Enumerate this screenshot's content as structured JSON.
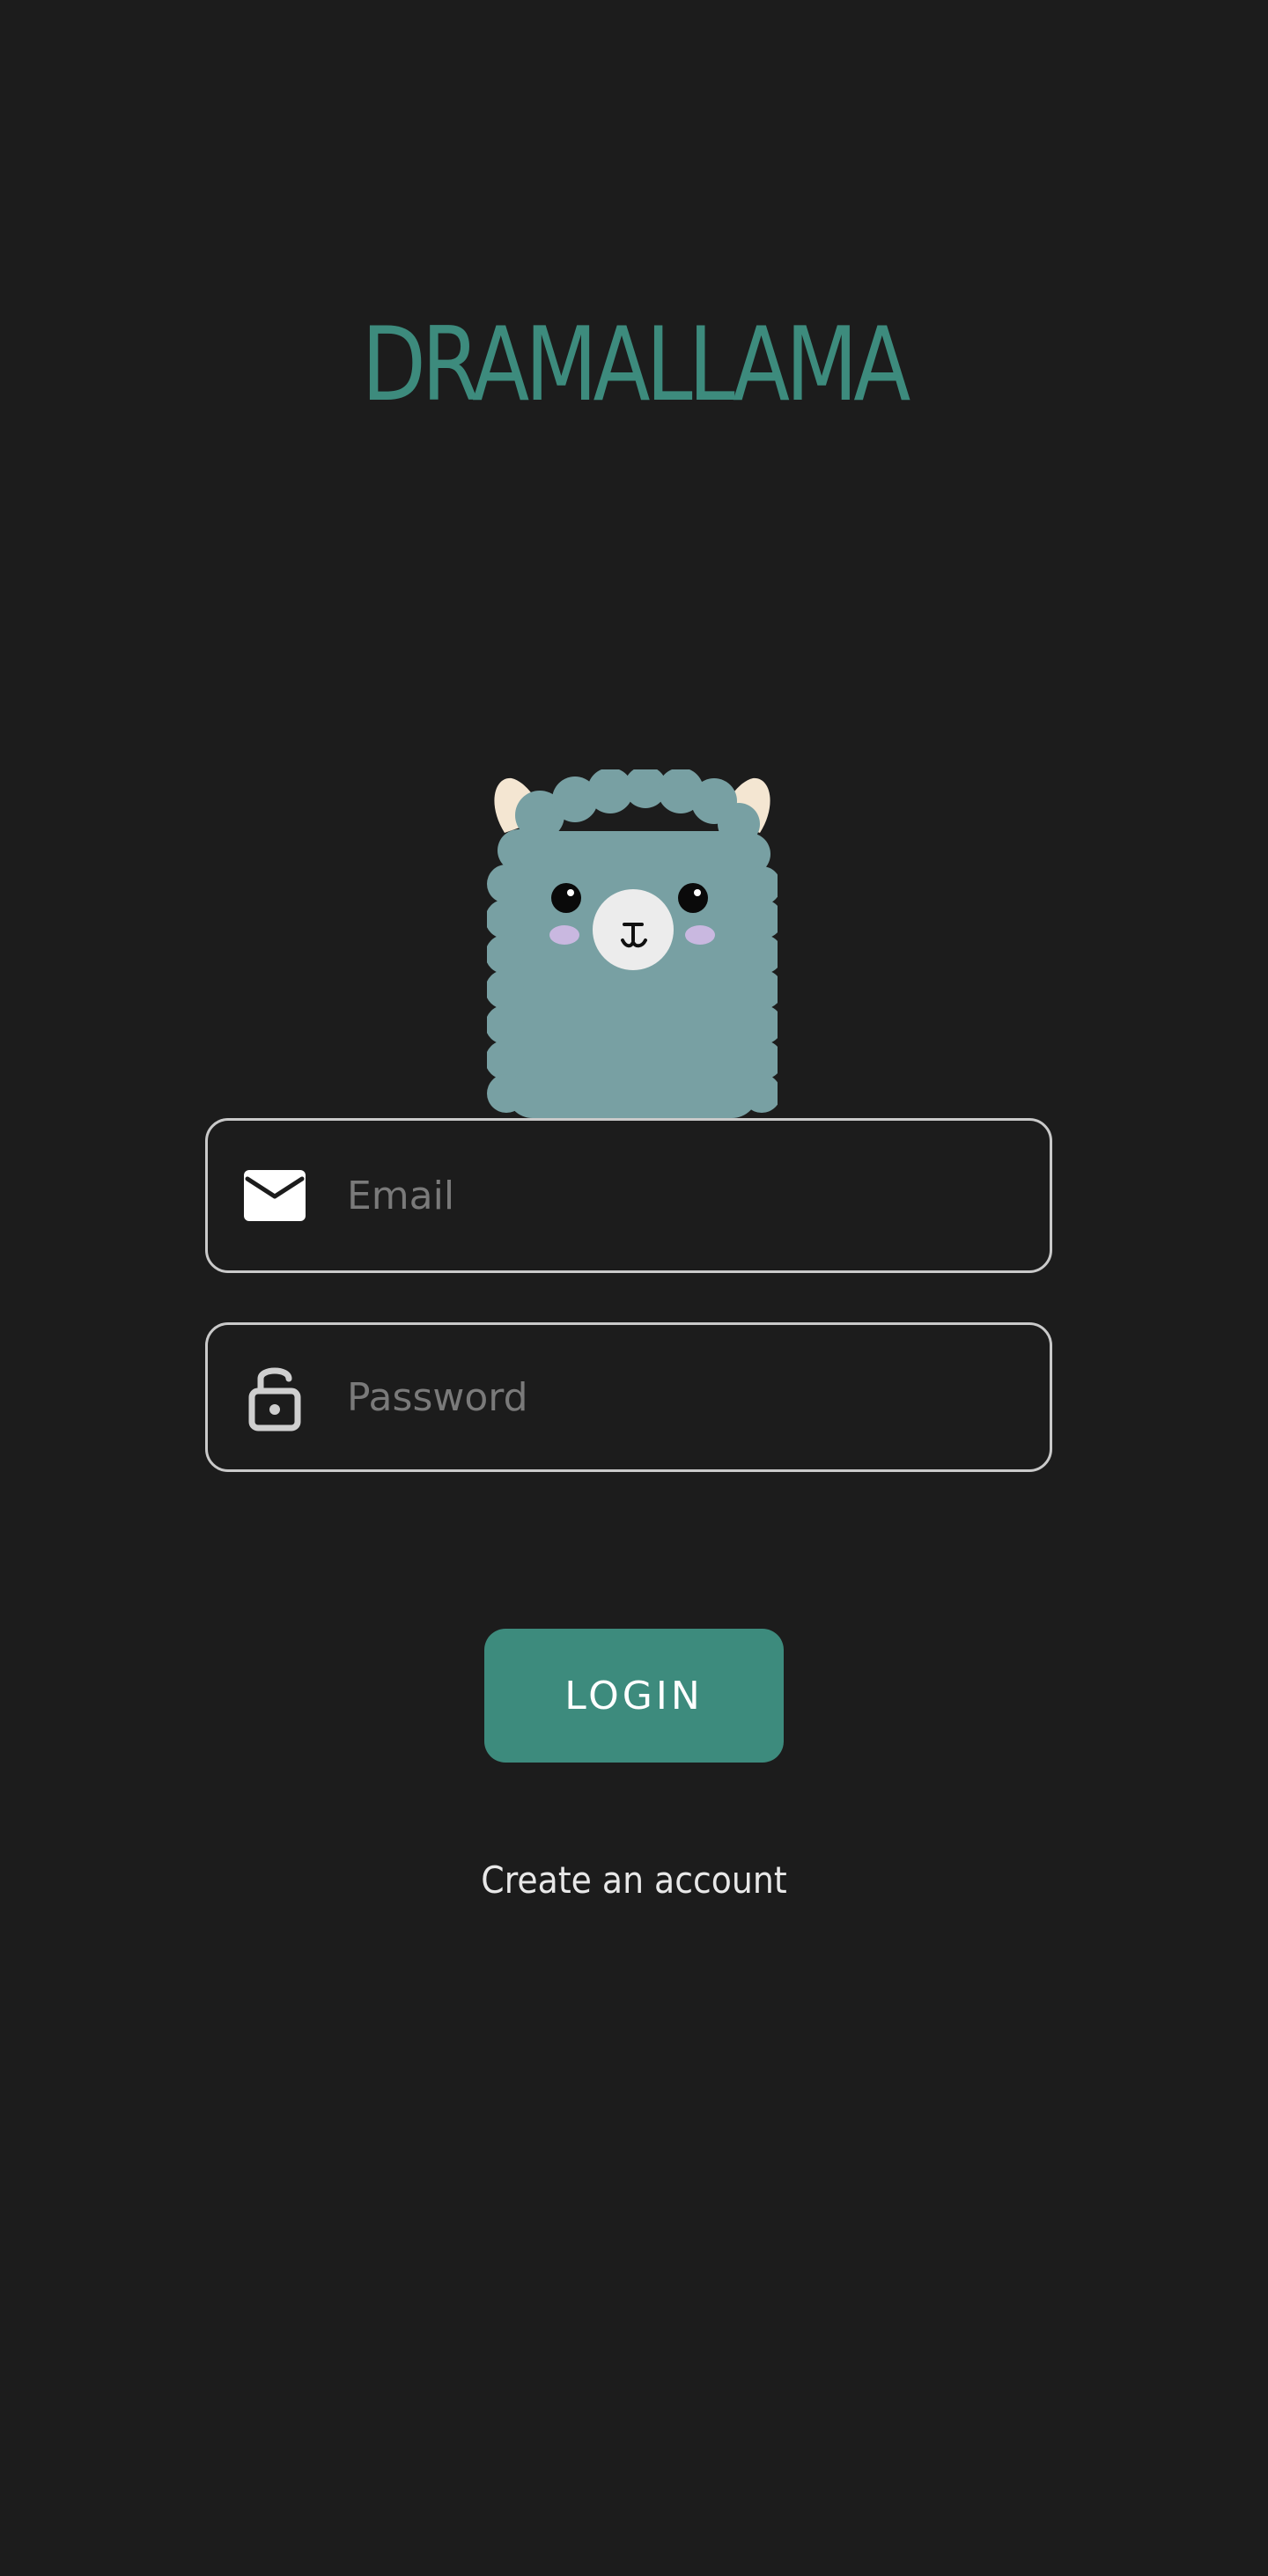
{
  "app": {
    "title": "DRAMALLAMA"
  },
  "mascot": {
    "icon": "llama-mascot"
  },
  "login_form": {
    "email": {
      "icon": "envelope-icon",
      "placeholder": "Email",
      "value": ""
    },
    "password": {
      "icon": "lock-icon",
      "placeholder": "Password",
      "value": ""
    },
    "login_label": "LOGIN",
    "create_account_label": "Create an account"
  },
  "colors": {
    "background": "#1c1c1c",
    "accent": "#3d8b7d",
    "field_border": "#c9c9c9",
    "llama_fur": "#78a0a3",
    "llama_ear": "#f4e6d2",
    "llama_cheek": "#c9b8e0"
  }
}
